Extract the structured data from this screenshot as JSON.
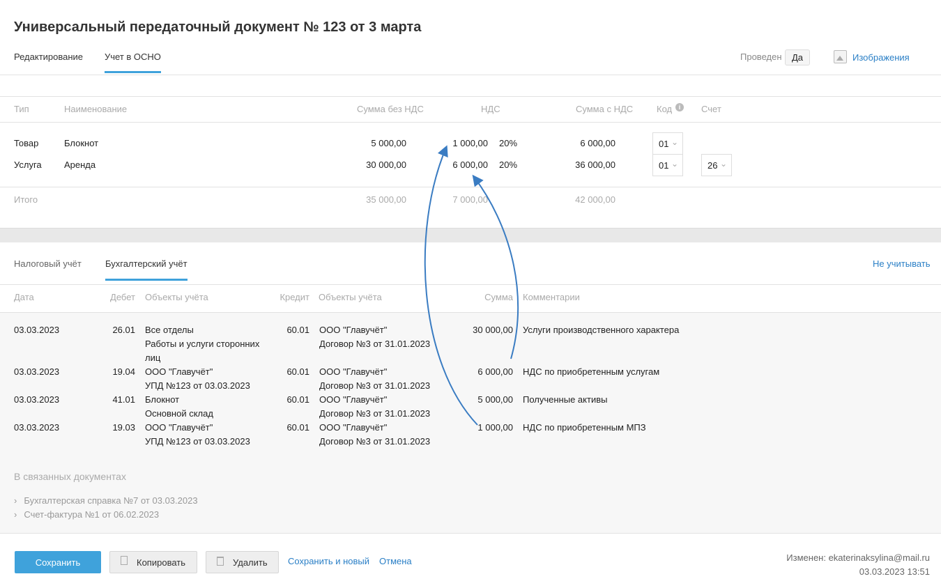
{
  "title": "Универсальный передаточный документ № 123 от 3 марта",
  "tabs": [
    "Редактирование",
    "Учет в ОСНО"
  ],
  "posted_label": "Проведен",
  "posted_value": "Да",
  "images_link": "Изображения",
  "table": {
    "headers": [
      "Тип",
      "Наименование",
      "Сумма без НДС",
      "НДС",
      "Сумма с НДС",
      "Код",
      "Счет"
    ],
    "rows": [
      {
        "type": "Товар",
        "name": "Блокнот",
        "sum": "5 000,00",
        "vat": "1 000,00",
        "rate": "20%",
        "total": "6 000,00",
        "code": "01",
        "account": ""
      },
      {
        "type": "Услуга",
        "name": "Аренда",
        "sum": "30 000,00",
        "vat": "6 000,00",
        "rate": "20%",
        "total": "36 000,00",
        "code": "01",
        "account": "26"
      }
    ],
    "total": {
      "label": "Итого",
      "sum": "35 000,00",
      "vat": "7 000,00",
      "total": "42 000,00"
    }
  },
  "subtabs": [
    "Налоговый учёт",
    "Бухгалтерский учёт"
  ],
  "ignore_link": "Не учитывать",
  "ledger": {
    "headers": [
      "Дата",
      "Дебет",
      "Объекты учёта",
      "Кредит",
      "Объекты учёта",
      "Сумма",
      "Комментарии"
    ],
    "rows": [
      {
        "date": "03.03.2023",
        "debit": "26.01",
        "dobj1": "Все отделы",
        "dobj2": "Работы и услуги сторонних",
        "dobj3": "лиц",
        "credit": "60.01",
        "cobj1": "ООО \"Главучёт\"",
        "cobj2": "Договор №3 от 31.01.2023",
        "sum": "30 000,00",
        "comment": "Услуги производственного характера"
      },
      {
        "date": "03.03.2023",
        "debit": "19.04",
        "dobj1": "ООО \"Главучёт\"",
        "dobj2": "УПД №123 от 03.03.2023",
        "credit": "60.01",
        "cobj1": "ООО \"Главучёт\"",
        "cobj2": "Договор №3 от 31.01.2023",
        "sum": "6 000,00",
        "comment": "НДС по приобретенным услугам"
      },
      {
        "date": "03.03.2023",
        "debit": "41.01",
        "dobj1": "Блокнот",
        "dobj2": "Основной склад",
        "credit": "60.01",
        "cobj1": "ООО \"Главучёт\"",
        "cobj2": "Договор №3 от 31.01.2023",
        "sum": "5 000,00",
        "comment": "Полученные активы"
      },
      {
        "date": "03.03.2023",
        "debit": "19.03",
        "dobj1": "ООО \"Главучёт\"",
        "dobj2": "УПД №123 от 03.03.2023",
        "credit": "60.01",
        "cobj1": "ООО \"Главучёт\"",
        "cobj2": "Договор №3 от 31.01.2023",
        "sum": "1 000,00",
        "comment": "НДС по приобретенным МПЗ"
      }
    ]
  },
  "related": {
    "title": "В связанных документах",
    "items": [
      "Бухгалтерская справка №7 от 03.03.2023",
      "Счет-фактура №1 от 06.02.2023"
    ]
  },
  "footer": {
    "save": "Сохранить",
    "copy": "Копировать",
    "delete": "Удалить",
    "save_new": "Сохранить и новый",
    "cancel": "Отмена",
    "modified": "Изменен: ekaterinaksylina@mail.ru",
    "modified_date": "03.03.2023 13:51"
  }
}
